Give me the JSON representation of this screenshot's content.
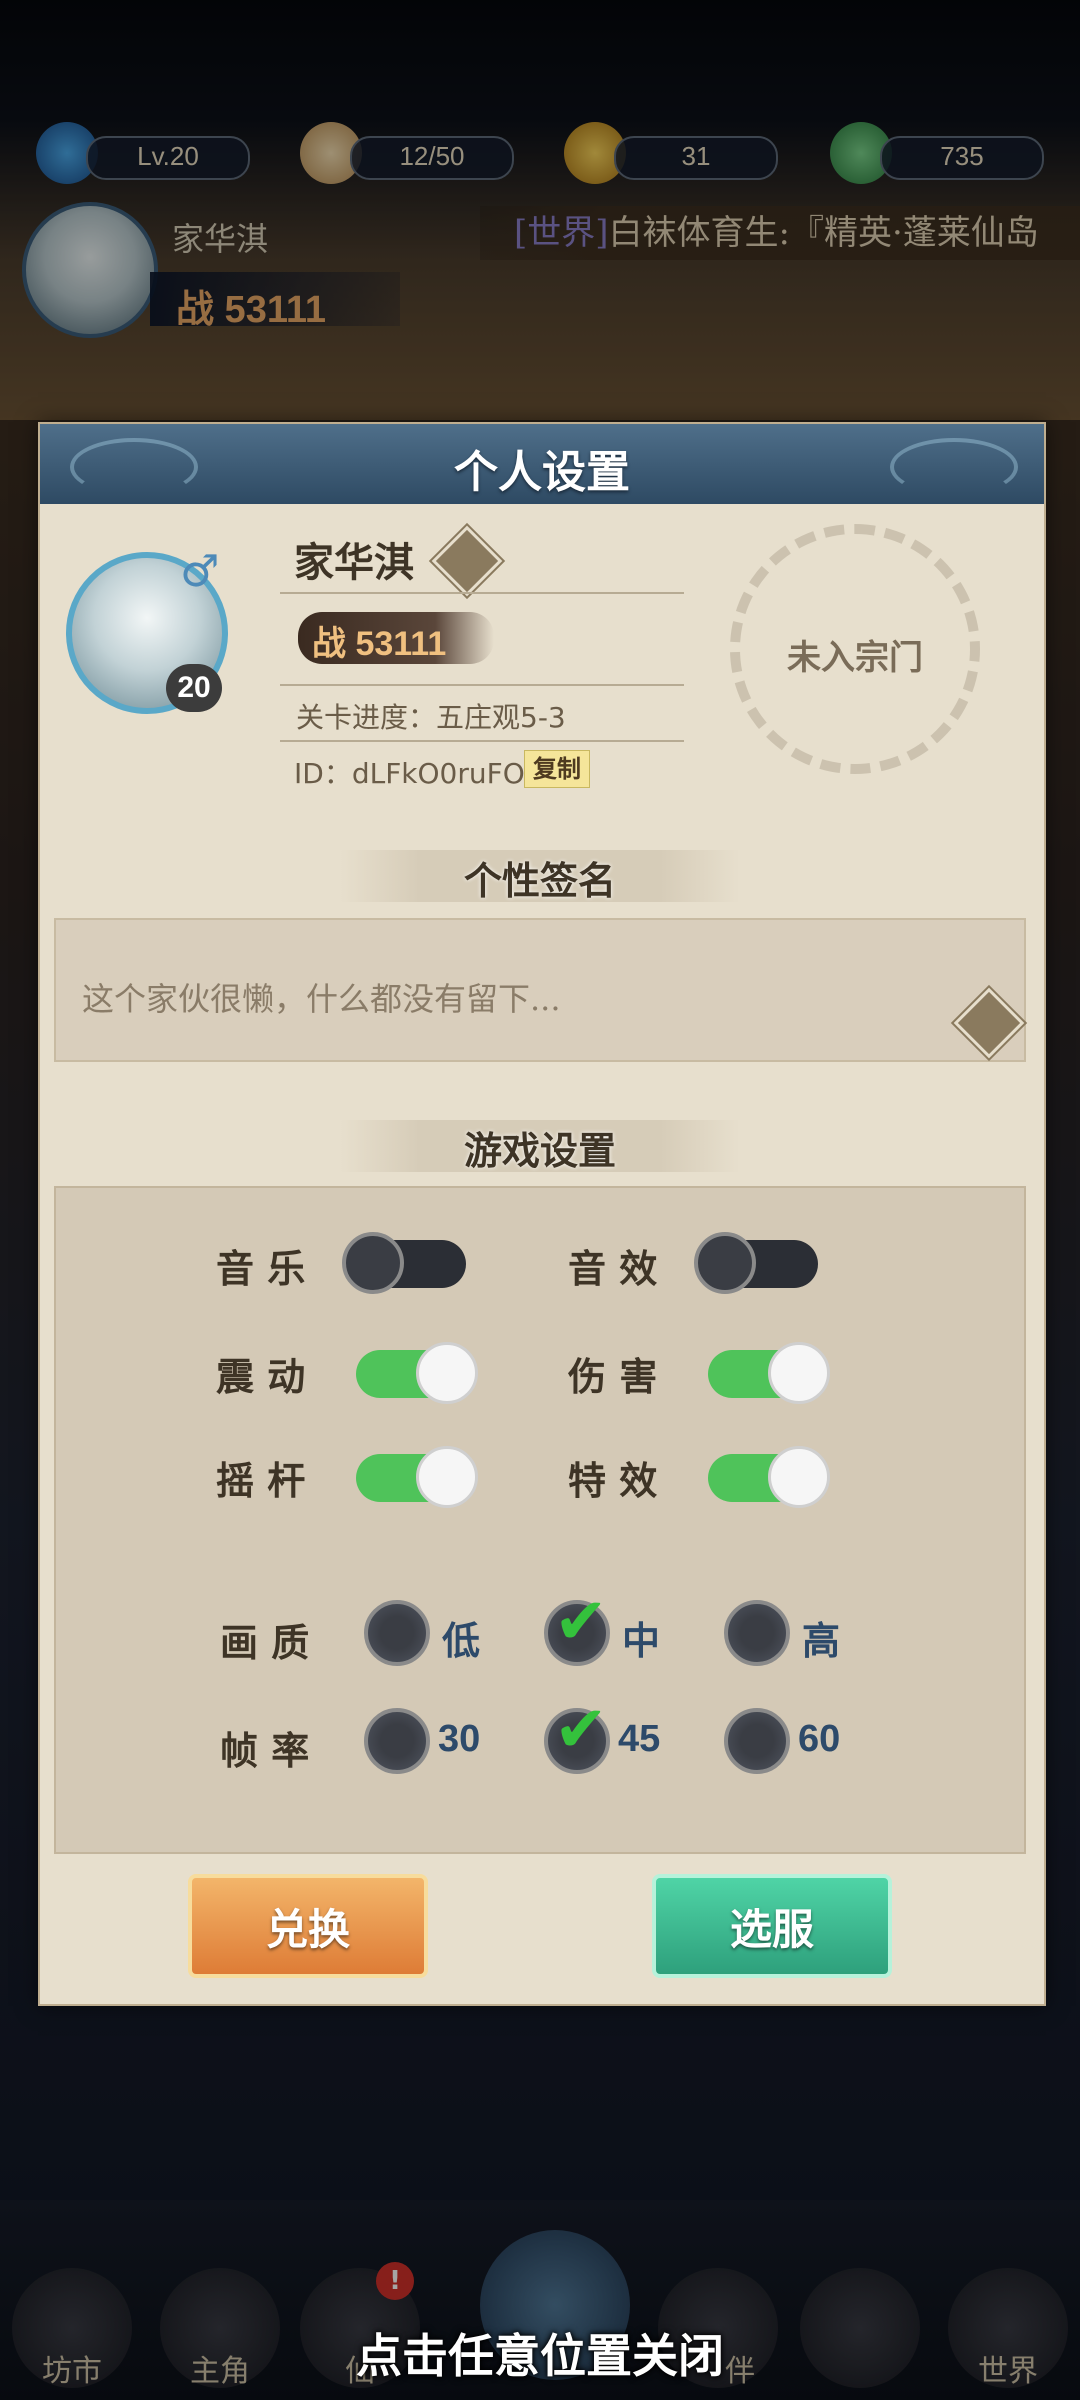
{
  "status_bar": {
    "level": "Lv.20",
    "stamina": "12/50",
    "coins": "31",
    "jade": "735"
  },
  "player_header": {
    "name": "家华淇",
    "power": "战 53111"
  },
  "world_ticker": {
    "channel": "[世界]",
    "message": "白袜体育生:『精英·蓬莱仙岛"
  },
  "panel": {
    "title": "个人设置",
    "profile": {
      "name": "家华淇",
      "level": "20",
      "power_label": "战",
      "power_value": "53111",
      "stage_progress": "关卡进度：五庄观5-3",
      "id_text": "ID：dLFkO0ruFO",
      "copy_button": "复制",
      "sect_status": "未入宗门"
    },
    "signature": {
      "header": "个性签名",
      "text": "这个家伙很懒，什么都没有留下..."
    },
    "game_settings": {
      "header": "游戏设置",
      "toggles": [
        {
          "label": "音 乐",
          "on": false
        },
        {
          "label": "音 效",
          "on": false
        },
        {
          "label": "震 动",
          "on": true
        },
        {
          "label": "伤 害",
          "on": true
        },
        {
          "label": "摇 杆",
          "on": true
        },
        {
          "label": "特 效",
          "on": true
        }
      ],
      "quality": {
        "label": "画 质",
        "options": [
          "低",
          "中",
          "高"
        ],
        "selected": "中"
      },
      "framerate": {
        "label": "帧 率",
        "options": [
          "30",
          "45",
          "60"
        ],
        "selected": "45"
      }
    },
    "buttons": {
      "redeem": "兑换",
      "select_server": "选服"
    }
  },
  "bottom_nav": {
    "items": [
      "坊市",
      "主角",
      "仙",
      "",
      "伴",
      "",
      "世界"
    ],
    "badge": "!"
  },
  "close_hint": "点击任意位置关闭",
  "colors": {
    "toggle_on": "#4fc35a",
    "toggle_off": "#2b2e35",
    "check": "#34c23c",
    "btn_orange": "#de7c36",
    "btn_green": "#2ea07c",
    "panel_bg": "#e7dfcd",
    "header_blue": "#2e4a63"
  }
}
